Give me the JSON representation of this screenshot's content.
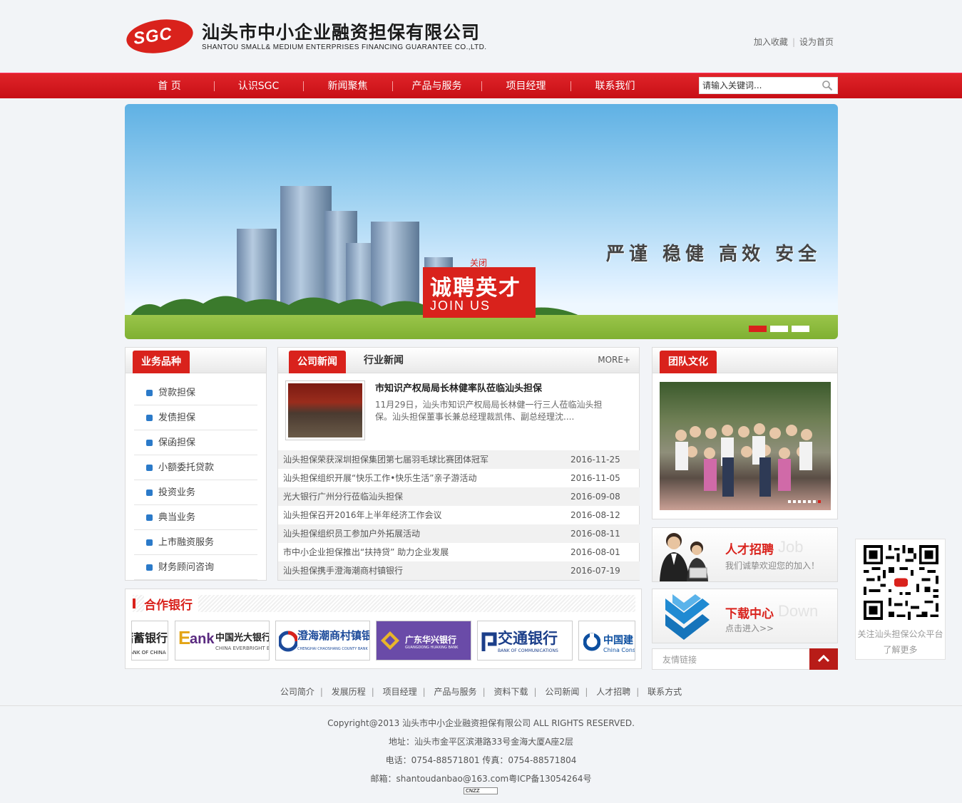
{
  "header": {
    "logo_mark": "SGC",
    "company_cn": "汕头市中小企业融资担保有限公司",
    "company_en": "SHANTOU SMALL& MEDIUM ENTERPRISES FINANCING GUARANTEE CO.,LTD.",
    "links": [
      "加入收藏",
      "设为首页"
    ]
  },
  "nav": {
    "items": [
      "首 页",
      "认识SGC",
      "新闻聚焦",
      "产品与服务",
      "项目经理",
      "联系我们"
    ],
    "search_placeholder": "请输入关键词..."
  },
  "banner": {
    "slogan": "严谨 稳健 高效 安全",
    "join_cn": "诚聘英才",
    "join_en": "JOIN US",
    "close": "关闭",
    "slides": 3,
    "active_slide": 1
  },
  "business": {
    "title": "业务品种",
    "items": [
      "贷款担保",
      "发债担保",
      "保函担保",
      "小额委托贷款",
      "投资业务",
      "典当业务",
      "上市融资服务",
      "财务顾问咨询"
    ]
  },
  "news": {
    "tab_active": "公司新闻",
    "tab_other": "行业新闻",
    "more": "MORE+",
    "featured_title": "市知识产权局局长林健率队莅临汕头担保",
    "featured_desc": "11月29日，汕头市知识产权局局长林健一行三人莅临汕头担保。汕头担保董事长兼总经理裁凯伟、副总经理沈....",
    "rows": [
      {
        "title": "汕头担保荣获深圳担保集团第七届羽毛球比赛团体冠军",
        "date": "2016-11-25"
      },
      {
        "title": "汕头担保组织开展“快乐工作•快乐生活”亲子游活动",
        "date": "2016-11-05"
      },
      {
        "title": "光大银行广州分行莅临汕头担保",
        "date": "2016-09-08"
      },
      {
        "title": "汕头担保召开2016年上半年经济工作会议",
        "date": "2016-08-12"
      },
      {
        "title": "汕头担保组织员工参加户外拓展活动",
        "date": "2016-08-11"
      },
      {
        "title": "市中小企业担保推出“扶持贷” 助力企业发展",
        "date": "2016-08-01"
      },
      {
        "title": "汕头担保携手澄海潮商村镇银行",
        "date": "2016-07-19"
      }
    ]
  },
  "culture": {
    "title": "团队文化"
  },
  "promos": {
    "recruit_title": "人才招聘",
    "recruit_en": "Job",
    "recruit_sub": "我们诚挚欢迎您的加入！",
    "download_title": "下载中心",
    "download_en": "Down",
    "download_sub": "点击进入>>"
  },
  "friend_links": "友情链接",
  "banks": {
    "title": "合作银行",
    "items": [
      {
        "cn": "储蓄银行",
        "en": "BANK OF CHINA"
      },
      {
        "cn": "中国光大银行",
        "en": "CHINA EVERBRIGHT BANK"
      },
      {
        "cn": "澄海潮商村镇银行",
        "en": "CHENGHAI CHAOSHANG COUNTY BANK"
      },
      {
        "cn": "广东华兴银行",
        "en": "GUANGDONG HUAXING BANK"
      },
      {
        "cn": "交通银行",
        "en": "BANK OF COMMUNICATIONS"
      },
      {
        "cn": "中国建",
        "en": "China Constru"
      }
    ]
  },
  "qr": {
    "line1": "关注汕头担保公众平台",
    "line2": "了解更多"
  },
  "footer": {
    "nav": [
      "公司简介",
      "发展历程",
      "项目经理",
      "产品与服务",
      "资料下载",
      "公司新闻",
      "人才招聘",
      "联系方式"
    ],
    "copyright": "Copyright@2013 汕头市中小企业融资担保有限公司 ALL RIGHTS RESERVED.",
    "address": "地址：汕头市金平区滨港路33号金海大厦A座2层",
    "phone": "电话：0754-88571801 传真：0754-88571804",
    "email": "邮箱：shantoudanbao@163.com粤ICP备13054264号",
    "badge": "CNZZ"
  },
  "colors": {
    "brand_red": "#d9221c",
    "blue_bullet": "#2b7ac9"
  }
}
